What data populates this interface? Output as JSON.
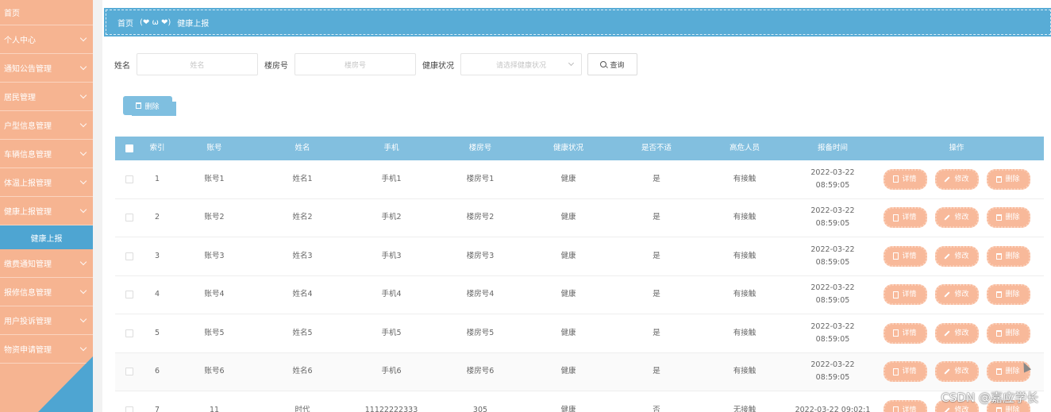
{
  "sidebar": {
    "home": "首页",
    "items": [
      {
        "label": "个人中心"
      },
      {
        "label": "通知公告管理"
      },
      {
        "label": "居民管理"
      },
      {
        "label": "户型信息管理"
      },
      {
        "label": "车辆信息管理"
      },
      {
        "label": "体温上报管理"
      },
      {
        "label": "健康上报管理"
      }
    ],
    "active_sub": "健康上报",
    "items_after": [
      {
        "label": "缴费通知管理"
      },
      {
        "label": "报修信息管理"
      },
      {
        "label": "用户投诉管理"
      },
      {
        "label": "物资申请管理"
      }
    ],
    "colors": {
      "bg": "#f6b491",
      "active": "#4ea5d2"
    }
  },
  "breadcrumb": {
    "home": "首页",
    "separator": "(❤ ω ❤)",
    "current": "健康上报"
  },
  "search": {
    "name_label": "姓名",
    "name_placeholder": "姓名",
    "building_label": "楼房号",
    "building_placeholder": "楼房号",
    "health_label": "健康状况",
    "health_placeholder": "请选择健康状况",
    "query_button": "查询"
  },
  "toolbar": {
    "delete_label": "删除"
  },
  "table": {
    "headers": [
      "索引",
      "账号",
      "姓名",
      "手机",
      "楼房号",
      "健康状况",
      "是否不适",
      "高危人员",
      "报备时间",
      "操作"
    ],
    "rows": [
      {
        "idx": "1",
        "account": "账号1",
        "name": "姓名1",
        "phone": "手机1",
        "building": "楼房号1",
        "health": "健康",
        "unwell": "是",
        "risk": "有接触",
        "time": "2022-03-22 08:59:05"
      },
      {
        "idx": "2",
        "account": "账号2",
        "name": "姓名2",
        "phone": "手机2",
        "building": "楼房号2",
        "health": "健康",
        "unwell": "是",
        "risk": "有接触",
        "time": "2022-03-22 08:59:05"
      },
      {
        "idx": "3",
        "account": "账号3",
        "name": "姓名3",
        "phone": "手机3",
        "building": "楼房号3",
        "health": "健康",
        "unwell": "是",
        "risk": "有接触",
        "time": "2022-03-22 08:59:05"
      },
      {
        "idx": "4",
        "account": "账号4",
        "name": "姓名4",
        "phone": "手机4",
        "building": "楼房号4",
        "health": "健康",
        "unwell": "是",
        "risk": "有接触",
        "time": "2022-03-22 08:59:05"
      },
      {
        "idx": "5",
        "account": "账号5",
        "name": "姓名5",
        "phone": "手机5",
        "building": "楼房号5",
        "health": "健康",
        "unwell": "是",
        "risk": "有接触",
        "time": "2022-03-22 08:59:05"
      },
      {
        "idx": "6",
        "account": "账号6",
        "name": "姓名6",
        "phone": "手机6",
        "building": "楼房号6",
        "health": "健康",
        "unwell": "是",
        "risk": "有接触",
        "time": "2022-03-22 08:59:05"
      },
      {
        "idx": "7",
        "account": "11",
        "name": "时代",
        "phone": "11122222333",
        "building": "305",
        "health": "健康",
        "unwell": "否",
        "risk": "无接触",
        "time": "2022-03-22 09:02:1"
      }
    ],
    "ops": {
      "detail": "详情",
      "edit": "修改",
      "delete": "删除"
    },
    "colors": {
      "header": "#82bfdf",
      "op_button": "#f8b99a"
    }
  },
  "watermark": "CSDN @嘉应学长"
}
